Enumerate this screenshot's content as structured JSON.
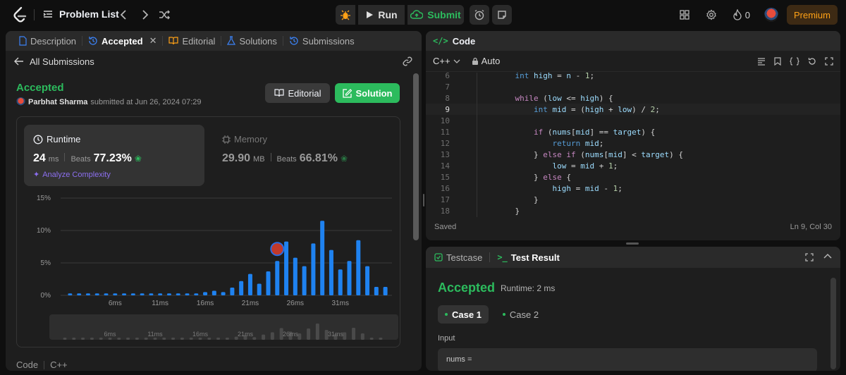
{
  "topbar": {
    "problem_list": "Problem List",
    "run": "Run",
    "submit": "Submit",
    "streak": "0",
    "premium": "Premium"
  },
  "left_tabs": [
    {
      "label": "Description"
    },
    {
      "label": "Accepted"
    },
    {
      "label": "Editorial"
    },
    {
      "label": "Solutions"
    },
    {
      "label": "Submissions"
    }
  ],
  "back_link": "All Submissions",
  "result": {
    "status": "Accepted",
    "user": "Parbhat Sharma",
    "submitted_at": "submitted at Jun 26, 2024 07:29",
    "editorial_btn": "Editorial",
    "solution_btn": "Solution"
  },
  "runtime": {
    "label": "Runtime",
    "value": "24",
    "unit": "ms",
    "beats_label": "Beats",
    "beats": "77.23%",
    "analyze": "Analyze Complexity"
  },
  "memory": {
    "label": "Memory",
    "value": "29.90",
    "unit": "MB",
    "beats_label": "Beats",
    "beats": "66.81%"
  },
  "chart_data": {
    "type": "bar",
    "y_ticks": [
      "15%",
      "10%",
      "5%",
      "0%"
    ],
    "ylim": [
      0,
      15
    ],
    "x_labels": [
      {
        "label": "6ms",
        "index": 5
      },
      {
        "label": "11ms",
        "index": 10
      },
      {
        "label": "16ms",
        "index": 15
      },
      {
        "label": "21ms",
        "index": 20
      },
      {
        "label": "26ms",
        "index": 25
      },
      {
        "label": "31ms",
        "index": 30
      }
    ],
    "values": [
      0.3,
      0.3,
      0.3,
      0.3,
      0.3,
      0.3,
      0.3,
      0.3,
      0.3,
      0.3,
      0.3,
      0.3,
      0.3,
      0.3,
      0.3,
      0.5,
      0.7,
      0.5,
      1.2,
      2.2,
      3.3,
      1.8,
      3.7,
      5.3,
      8.3,
      5.8,
      4.5,
      8.0,
      11.5,
      7.0,
      4.0,
      5.3,
      8.5,
      4.5,
      1.3,
      1.3
    ],
    "highlight_index": 23,
    "color": "#1f82f0"
  },
  "left_footer": {
    "code": "Code",
    "lang": "C++"
  },
  "code_panel": {
    "title": "Code",
    "language": "C++",
    "mode": "Auto",
    "status": "Saved",
    "cursor": "Ln 9, Col 30"
  },
  "code_lines": [
    {
      "n": "6",
      "text": "    int high = n - 1;"
    },
    {
      "n": "7",
      "text": ""
    },
    {
      "n": "8",
      "text": "    while (low <= high) {"
    },
    {
      "n": "9",
      "text": "        int mid = (high + low) / 2;"
    },
    {
      "n": "10",
      "text": ""
    },
    {
      "n": "11",
      "text": "        if (nums[mid] == target) {"
    },
    {
      "n": "12",
      "text": "            return mid;"
    },
    {
      "n": "13",
      "text": "        } else if (nums[mid] < target) {"
    },
    {
      "n": "14",
      "text": "            low = mid + 1;"
    },
    {
      "n": "15",
      "text": "        } else {"
    },
    {
      "n": "16",
      "text": "            high = mid - 1;"
    },
    {
      "n": "17",
      "text": "        }"
    },
    {
      "n": "18",
      "text": "    }"
    }
  ],
  "test_panel": {
    "testcase_tab": "Testcase",
    "result_tab": "Test Result",
    "status": "Accepted",
    "runtime": "Runtime: 2 ms",
    "cases": [
      "Case 1",
      "Case 2"
    ],
    "input_label": "Input",
    "input_value": "nums ="
  },
  "colors": {
    "accent_green": "#2cbb5d",
    "brand_orange": "#ffa116",
    "bar_blue": "#1f82f0"
  }
}
